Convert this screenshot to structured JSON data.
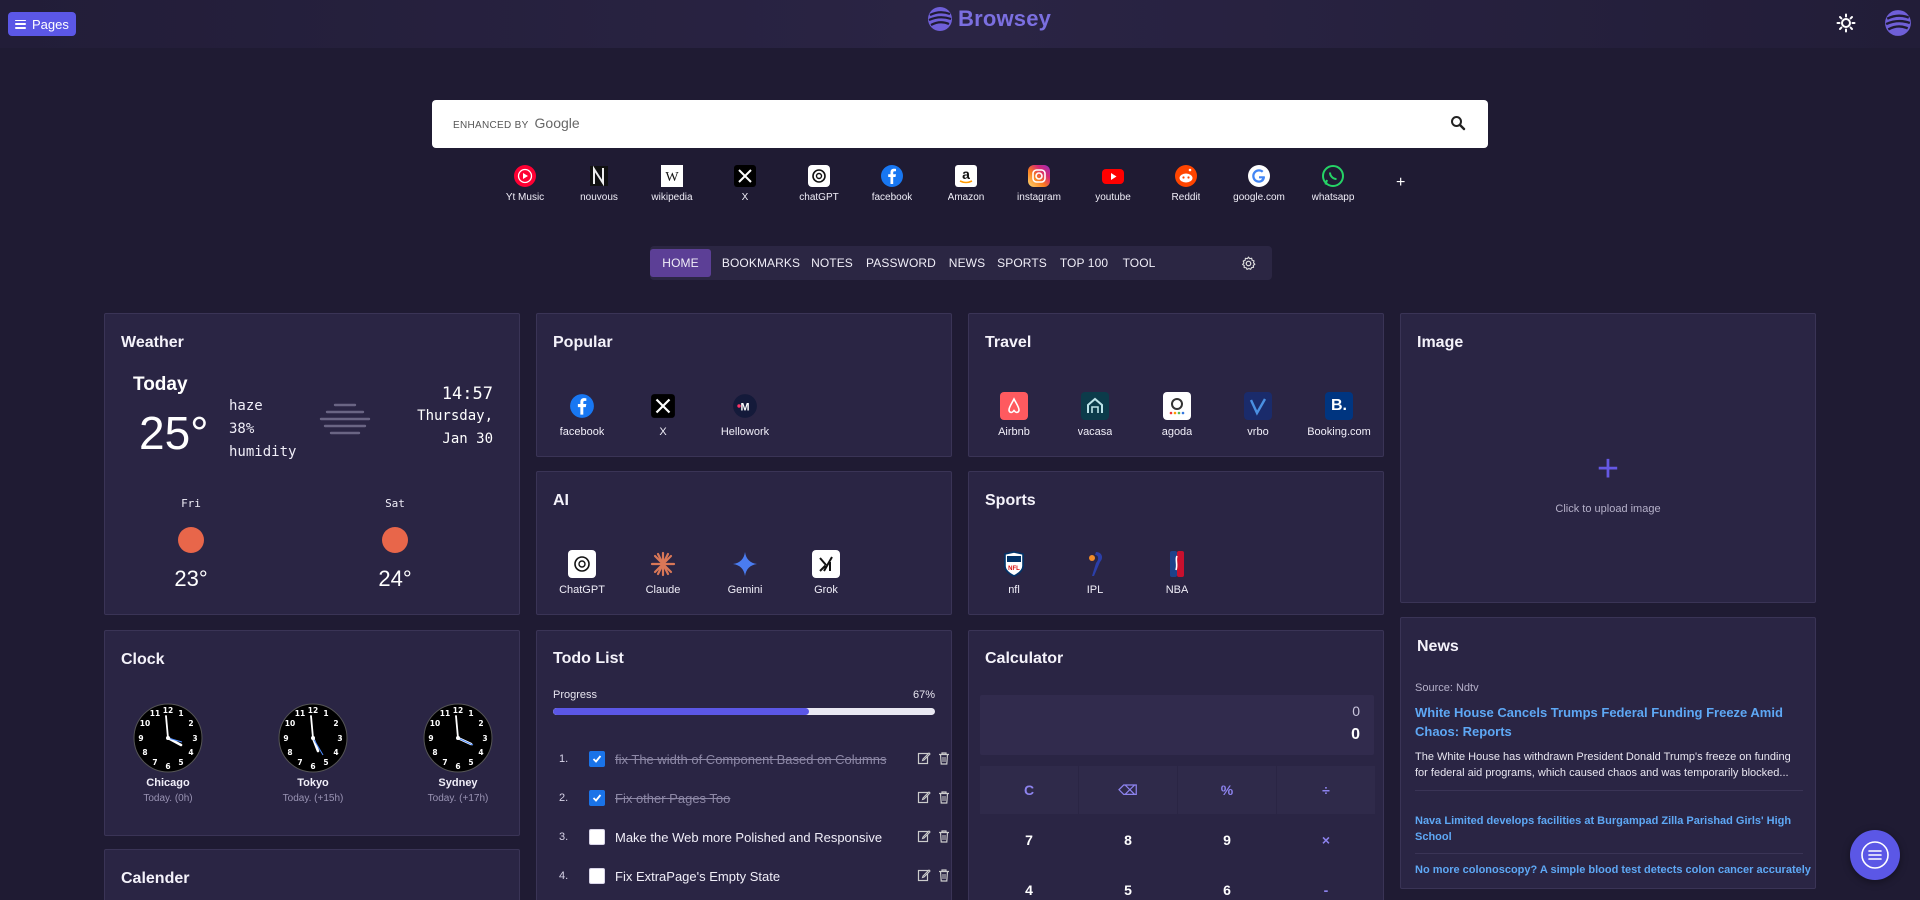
{
  "topbar": {
    "pages_label": "Pages",
    "brand": "Browsey"
  },
  "search": {
    "enhanced_label": "ENHANCED BY",
    "google_label": "Google",
    "value": ""
  },
  "shortcuts": [
    {
      "label": "Yt Music",
      "icon": "yt-music-icon"
    },
    {
      "label": "nouvous",
      "icon": "nouvous-icon"
    },
    {
      "label": "wikipedia",
      "icon": "wikipedia-icon"
    },
    {
      "label": "X",
      "icon": "x-icon"
    },
    {
      "label": "chatGPT",
      "icon": "chatgpt-icon"
    },
    {
      "label": "facebook",
      "icon": "facebook-icon"
    },
    {
      "label": "Amazon",
      "icon": "amazon-icon"
    },
    {
      "label": "instagram",
      "icon": "instagram-icon"
    },
    {
      "label": "youtube",
      "icon": "youtube-icon"
    },
    {
      "label": "Reddit",
      "icon": "reddit-icon"
    },
    {
      "label": "google.com",
      "icon": "google-icon"
    },
    {
      "label": "whatsapp",
      "icon": "whatsapp-icon"
    }
  ],
  "shortcut_add": "+",
  "nav": [
    "HOME",
    "BOOKMARKS",
    "NOTES",
    "PASSWORD",
    "NEWS",
    "SPORTS",
    "TOP 100",
    "TOOL"
  ],
  "weather": {
    "title": "Weather",
    "today_label": "Today",
    "temp": "25°",
    "condition": "haze",
    "humidity_value": "38%",
    "humidity_label": "humidity",
    "time": "14:57",
    "day": "Thursday,",
    "date": "Jan 30",
    "forecast": [
      {
        "day": "Fri",
        "temp": "23°"
      },
      {
        "day": "Sat",
        "temp": "24°"
      }
    ]
  },
  "popular": {
    "title": "Popular",
    "items": [
      {
        "label": "facebook",
        "icon": "facebook-icon"
      },
      {
        "label": "X",
        "icon": "x-icon"
      },
      {
        "label": "Hellowork",
        "icon": "hellowork-icon"
      }
    ]
  },
  "travel": {
    "title": "Travel",
    "items": [
      {
        "label": "Airbnb",
        "icon": "airbnb-icon"
      },
      {
        "label": "vacasa",
        "icon": "vacasa-icon"
      },
      {
        "label": "agoda",
        "icon": "agoda-icon"
      },
      {
        "label": "vrbo",
        "icon": "vrbo-icon"
      },
      {
        "label": "Booking.com",
        "icon": "booking-icon"
      }
    ]
  },
  "image_card": {
    "title": "Image",
    "upload_label": "Click to upload image",
    "plus": "+"
  },
  "ai": {
    "title": "AI",
    "items": [
      {
        "label": "ChatGPT",
        "icon": "chatgpt-icon"
      },
      {
        "label": "Claude",
        "icon": "claude-icon"
      },
      {
        "label": "Gemini",
        "icon": "gemini-icon"
      },
      {
        "label": "Grok",
        "icon": "grok-icon"
      }
    ]
  },
  "sports": {
    "title": "Sports",
    "items": [
      {
        "label": "nfl",
        "icon": "nfl-icon"
      },
      {
        "label": "IPL",
        "icon": "ipl-icon"
      },
      {
        "label": "NBA",
        "icon": "nba-icon"
      }
    ]
  },
  "clock": {
    "title": "Clock",
    "items": [
      {
        "city": "Chicago",
        "offset": "Today. (0h)"
      },
      {
        "city": "Tokyo",
        "offset": "Today. (+15h)"
      },
      {
        "city": "Sydney",
        "offset": "Today. (+17h)"
      }
    ]
  },
  "calender": {
    "title": "Calender"
  },
  "todo": {
    "title": "Todo List",
    "progress_label": "Progress",
    "progress_text": "67%",
    "progress": 0.67,
    "items": [
      {
        "num": "1.",
        "text": "fix The width of Component Based on Columns",
        "done": true
      },
      {
        "num": "2.",
        "text": "Fix other Pages Too",
        "done": true
      },
      {
        "num": "3.",
        "text": "Make the Web more Polished and Responsive",
        "done": false
      },
      {
        "num": "4.",
        "text": "Fix ExtraPage's Empty State",
        "done": false
      }
    ]
  },
  "calculator": {
    "title": "Calculator",
    "expression": "0",
    "result": "0",
    "keys": [
      [
        "C",
        "⌫",
        "%",
        "÷"
      ],
      [
        "7",
        "8",
        "9",
        "×"
      ],
      [
        "4",
        "5",
        "6",
        "-"
      ]
    ]
  },
  "news": {
    "title": "News",
    "source": "Source: Ndtv",
    "headline": "White House Cancels Trumps Federal Funding Freeze Amid Chaos: Reports",
    "summary": "The White House has withdrawn President Donald Trump's freeze on funding for federal aid programs, which caused chaos and was temporarily blocked...",
    "links": [
      "Nava Limited develops facilities at Burgampad Zilla Parishad Girls' High School",
      "No more colonoscopy? A simple blood test detects colon cancer accurately"
    ]
  },
  "colors": {
    "background": "#1f1b33",
    "card": "#2a2544",
    "accent": "#5b57e6",
    "nav_active": "#5c3f96",
    "link": "#5ea8f5",
    "sun": "#e8664a"
  }
}
